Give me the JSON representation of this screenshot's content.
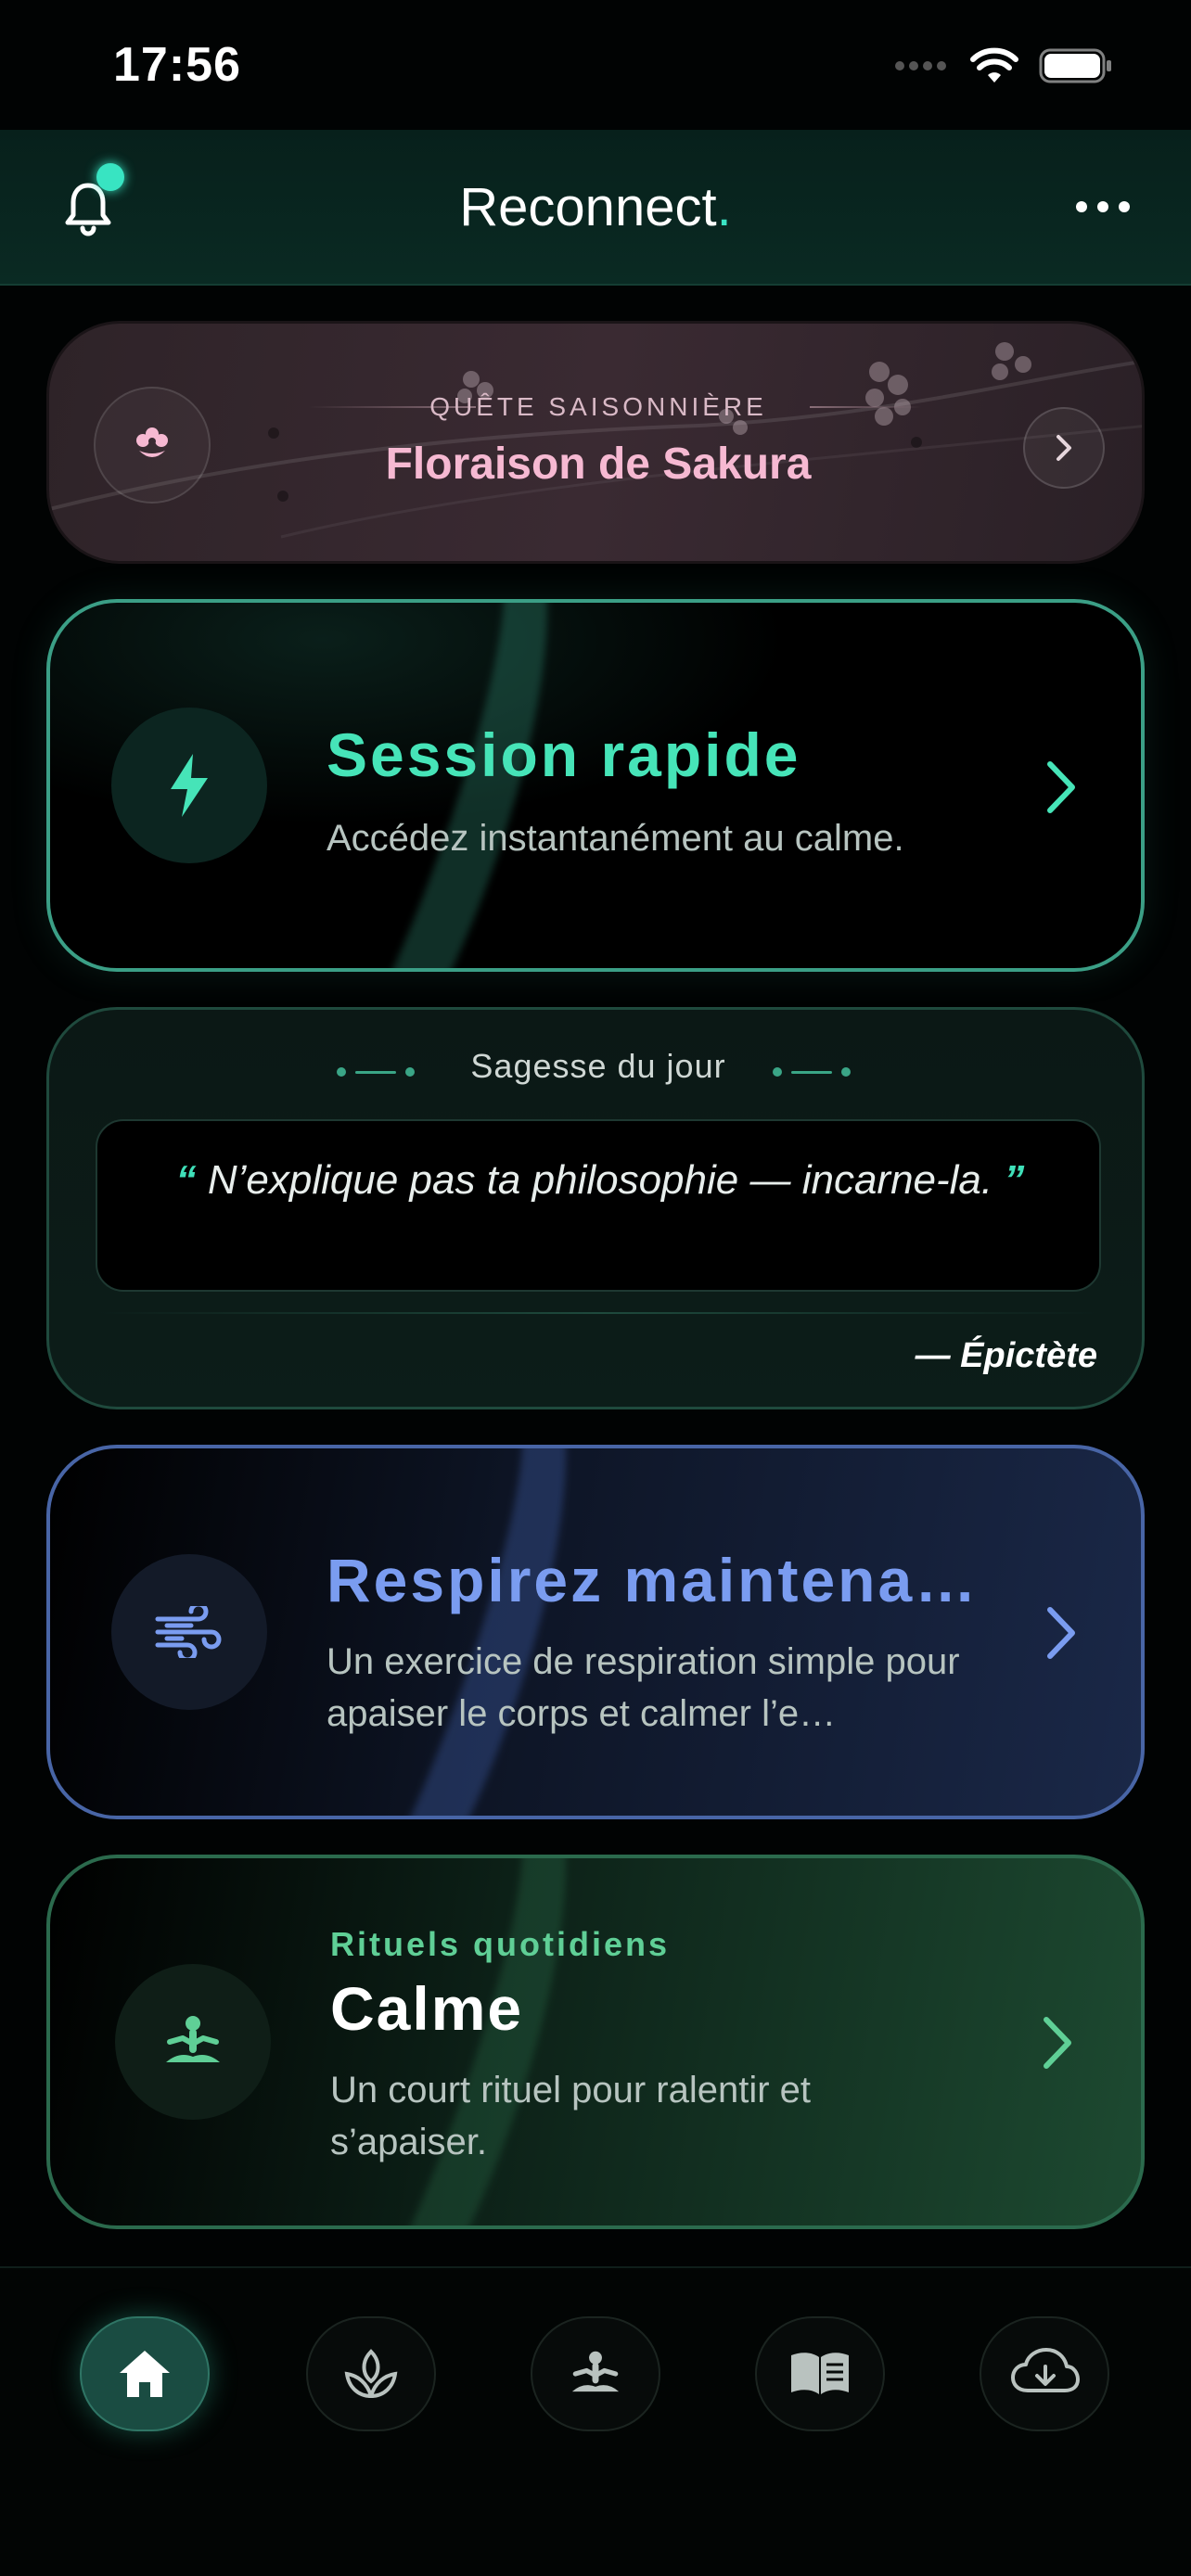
{
  "status_bar": {
    "time": "17:56"
  },
  "header": {
    "title": "Reconnect",
    "title_dot": "."
  },
  "quest": {
    "eyebrow": "QUÊTE SAISONNIÈRE",
    "title": "Floraison de Sakura",
    "accent": "#f6b9d2"
  },
  "session_card": {
    "title": "Session rapide",
    "subtitle": "Accédez instantanément au calme.",
    "accent": "#46e4b8",
    "icon": "bolt-icon"
  },
  "wisdom": {
    "header": "Sagesse du jour",
    "quote_open": "“",
    "quote_text": "N’explique pas ta philosophie — incarne-la.",
    "quote_close": "”",
    "author": "— Épictète"
  },
  "breathe_card": {
    "title": "Respirez maintena…",
    "subtitle": "Un exercice de respiration simple pour apaiser le corps et calmer l’e…",
    "accent": "#7a9cf0",
    "icon": "wind-icon"
  },
  "ritual_card": {
    "eyebrow": "Rituels quotidiens",
    "title": "Calme",
    "subtitle": "Un court rituel pour ralentir et s’apaiser.",
    "accent": "#5fcf96",
    "icon": "meditation-icon"
  },
  "tabbar": {
    "tabs": [
      "home-icon",
      "sprout-icon",
      "meditation-icon",
      "book-icon",
      "cloud-download-icon"
    ],
    "active": 0
  }
}
